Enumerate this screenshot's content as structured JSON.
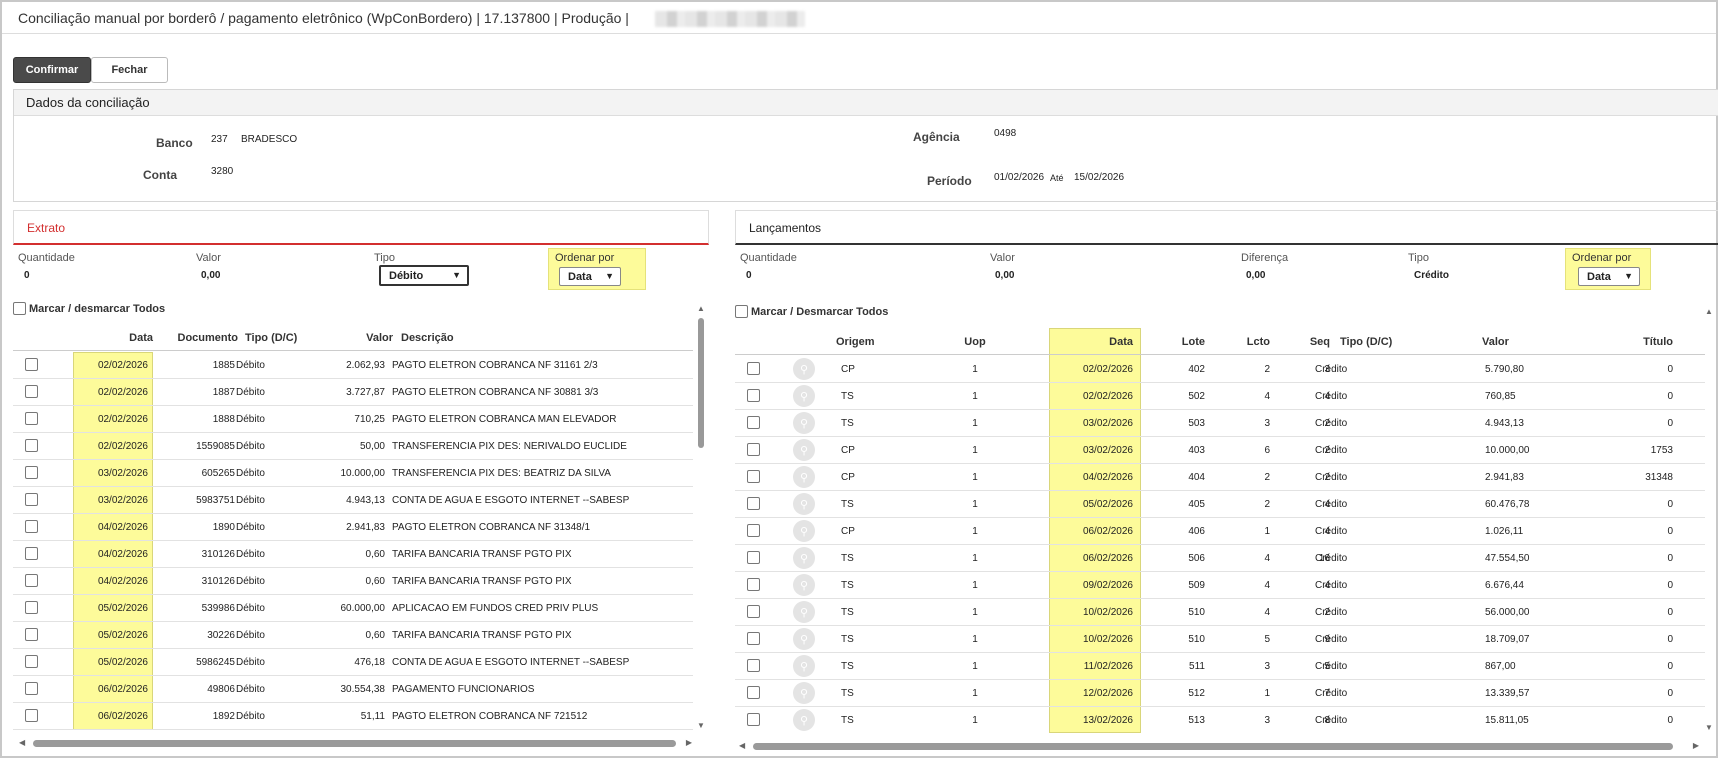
{
  "title": "Conciliação manual por borderô / pagamento eletrônico (WpConBordero) | 17.137800 | Produção |",
  "buttons": {
    "confirm": "Confirmar",
    "close": "Fechar"
  },
  "dados": {
    "header": "Dados da conciliação",
    "banco_label": "Banco",
    "banco_code": "237",
    "banco_name": "BRADESCO",
    "conta_label": "Conta",
    "conta_value": "3280",
    "agencia_label": "Agência",
    "agencia_value": "0498",
    "periodo_label": "Período",
    "periodo_from": "01/02/2026",
    "ate_label": "Até",
    "periodo_to": "15/02/2026"
  },
  "extrato": {
    "header": "Extrato",
    "quantidade_label": "Quantidade",
    "quantidade_value": "0",
    "valor_label": "Valor",
    "valor_value": "0,00",
    "tipo_label": "Tipo",
    "tipo_value": "Débito",
    "ordenar_label": "Ordenar por",
    "ordenar_value": "Data",
    "mark_all": "Marcar / desmarcar Todos",
    "columns": [
      "Data",
      "Documento",
      "Tipo (D/C)",
      "Valor",
      "Descrição"
    ],
    "rows": [
      [
        "02/02/2026",
        "1885",
        "Débito",
        "2.062,93",
        "PAGTO ELETRON COBRANCA NF 31161 2/3"
      ],
      [
        "02/02/2026",
        "1887",
        "Débito",
        "3.727,87",
        "PAGTO ELETRON COBRANCA NF 30881 3/3"
      ],
      [
        "02/02/2026",
        "1888",
        "Débito",
        "710,25",
        "PAGTO ELETRON COBRANCA MAN ELEVADOR"
      ],
      [
        "02/02/2026",
        "1559085",
        "Débito",
        "50,00",
        "TRANSFERENCIA PIX DES: NERIVALDO EUCLIDE"
      ],
      [
        "03/02/2026",
        "605265",
        "Débito",
        "10.000,00",
        "TRANSFERENCIA PIX DES: BEATRIZ DA SILVA"
      ],
      [
        "03/02/2026",
        "5983751",
        "Débito",
        "4.943,13",
        "CONTA DE AGUA E ESGOTO INTERNET --SABESP"
      ],
      [
        "04/02/2026",
        "1890",
        "Débito",
        "2.941,83",
        "PAGTO ELETRON COBRANCA NF 31348/1"
      ],
      [
        "04/02/2026",
        "310126",
        "Débito",
        "0,60",
        "TARIFA BANCARIA TRANSF PGTO PIX"
      ],
      [
        "04/02/2026",
        "310126",
        "Débito",
        "0,60",
        "TARIFA BANCARIA TRANSF PGTO PIX"
      ],
      [
        "05/02/2026",
        "539986",
        "Débito",
        "60.000,00",
        "APLICACAO EM FUNDOS CRED PRIV PLUS"
      ],
      [
        "05/02/2026",
        "30226",
        "Débito",
        "0,60",
        "TARIFA BANCARIA TRANSF PGTO PIX"
      ],
      [
        "05/02/2026",
        "5986245",
        "Débito",
        "476,18",
        "CONTA DE AGUA E ESGOTO INTERNET --SABESP"
      ],
      [
        "06/02/2026",
        "49806",
        "Débito",
        "30.554,38",
        "PAGAMENTO FUNCIONARIOS"
      ],
      [
        "06/02/2026",
        "1892",
        "Débito",
        "51,11",
        "PAGTO ELETRON COBRANCA NF 721512"
      ]
    ]
  },
  "lancamentos": {
    "header": "Lançamentos",
    "quantidade_label": "Quantidade",
    "quantidade_value": "0",
    "valor_label": "Valor",
    "valor_value": "0,00",
    "diferenca_label": "Diferença",
    "diferenca_value": "0,00",
    "tipo_label": "Tipo",
    "tipo_value": "Crédito",
    "ordenar_label": "Ordenar por",
    "ordenar_value": "Data",
    "mark_all": "Marcar / Desmarcar Todos",
    "columns": [
      "Origem",
      "Uop",
      "Data",
      "Lote",
      "Lcto",
      "Seq",
      "Tipo (D/C)",
      "Valor",
      "Título"
    ],
    "rows": [
      [
        "CP",
        "1",
        "02/02/2026",
        "402",
        "2",
        "3",
        "Crédito",
        "5.790,80",
        "0"
      ],
      [
        "TS",
        "1",
        "02/02/2026",
        "502",
        "4",
        "4",
        "Crédito",
        "760,85",
        "0"
      ],
      [
        "TS",
        "1",
        "03/02/2026",
        "503",
        "3",
        "2",
        "Crédito",
        "4.943,13",
        "0"
      ],
      [
        "CP",
        "1",
        "03/02/2026",
        "403",
        "6",
        "2",
        "Crédito",
        "10.000,00",
        "1753"
      ],
      [
        "CP",
        "1",
        "04/02/2026",
        "404",
        "2",
        "2",
        "Crédito",
        "2.941,83",
        "31348"
      ],
      [
        "TS",
        "1",
        "05/02/2026",
        "405",
        "2",
        "4",
        "Crédito",
        "60.476,78",
        "0"
      ],
      [
        "CP",
        "1",
        "06/02/2026",
        "406",
        "1",
        "4",
        "Crédito",
        "1.026,11",
        "0"
      ],
      [
        "TS",
        "1",
        "06/02/2026",
        "506",
        "4",
        "16",
        "Crédito",
        "47.554,50",
        "0"
      ],
      [
        "TS",
        "1",
        "09/02/2026",
        "509",
        "4",
        "4",
        "Crédito",
        "6.676,44",
        "0"
      ],
      [
        "TS",
        "1",
        "10/02/2026",
        "510",
        "4",
        "2",
        "Crédito",
        "56.000,00",
        "0"
      ],
      [
        "TS",
        "1",
        "10/02/2026",
        "510",
        "5",
        "9",
        "Crédito",
        "18.709,07",
        "0"
      ],
      [
        "TS",
        "1",
        "11/02/2026",
        "511",
        "3",
        "5",
        "Crédito",
        "867,00",
        "0"
      ],
      [
        "TS",
        "1",
        "12/02/2026",
        "512",
        "1",
        "7",
        "Crédito",
        "13.339,57",
        "0"
      ],
      [
        "TS",
        "1",
        "13/02/2026",
        "513",
        "3",
        "8",
        "Crédito",
        "15.811,05",
        "0"
      ]
    ]
  },
  "icons": {
    "row_search": "magnifier-icon",
    "select": "chevron-down-icon"
  },
  "colors": {
    "highlight": "#fdfb9a",
    "extrato_accent": "#d32f2f",
    "confirm_bg": "#4a4a4a"
  }
}
